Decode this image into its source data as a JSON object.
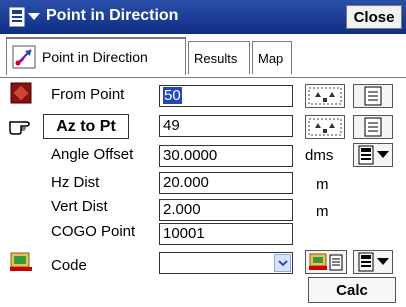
{
  "window": {
    "title": "Point in Direction",
    "close_label": "Close"
  },
  "tabs": [
    {
      "label": "Point in Direction",
      "active": true
    },
    {
      "label": "Results",
      "active": false
    },
    {
      "label": "Map",
      "active": false
    }
  ],
  "form": {
    "from_point": {
      "label": "From Point",
      "value": "50"
    },
    "az_to_pt": {
      "label": "Az to Pt",
      "value": "49"
    },
    "angle_offset": {
      "label": "Angle Offset",
      "value": "30.0000",
      "unit": "dms"
    },
    "hz_dist": {
      "label": "Hz Dist",
      "value": "20.000",
      "unit": "m"
    },
    "vert_dist": {
      "label": "Vert Dist",
      "value": "2.000",
      "unit": "m"
    },
    "cogo_point": {
      "label": "COGO Point",
      "value": "10001"
    },
    "code": {
      "label": "Code",
      "value": ""
    }
  },
  "actions": {
    "calc_label": "Calc"
  },
  "colors": {
    "title_bg": "#1a3a9a",
    "selection": "#2148b6"
  }
}
